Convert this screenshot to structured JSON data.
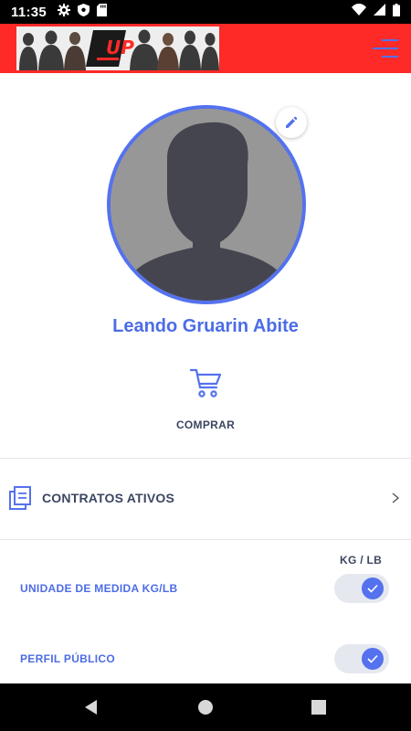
{
  "status_bar": {
    "time": "11:35",
    "left_icons": [
      "gear-icon",
      "shield-icon",
      "sd-card-icon"
    ],
    "right_icons": [
      "wifi-icon",
      "signal-icon",
      "battery-icon"
    ]
  },
  "header": {
    "banner_logo": "UP",
    "menu_icon": "hamburger-menu-icon",
    "colors": {
      "background": "#fe2a27"
    }
  },
  "profile": {
    "name": "Leando Gruarin Abite",
    "avatar_icon": "person-silhouette-icon",
    "edit_icon": "pencil-icon"
  },
  "actions": {
    "buy_label": "COMPRAR",
    "buy_icon": "cart-icon"
  },
  "contracts": {
    "label": "CONTRATOS ATIVOS",
    "icon": "document-copy-icon"
  },
  "settings": {
    "unit_header": "KG / LB",
    "items": [
      {
        "label": "UNIDADE DE MEDIDA KG/LB",
        "enabled": true
      },
      {
        "label": "PERFIL PÚBLICO",
        "enabled": true
      }
    ]
  },
  "colors": {
    "accent": "#5472ee",
    "text_dark": "#3c4662"
  },
  "nav_bar": {
    "buttons": [
      "back-icon",
      "home-icon",
      "recents-icon"
    ]
  }
}
